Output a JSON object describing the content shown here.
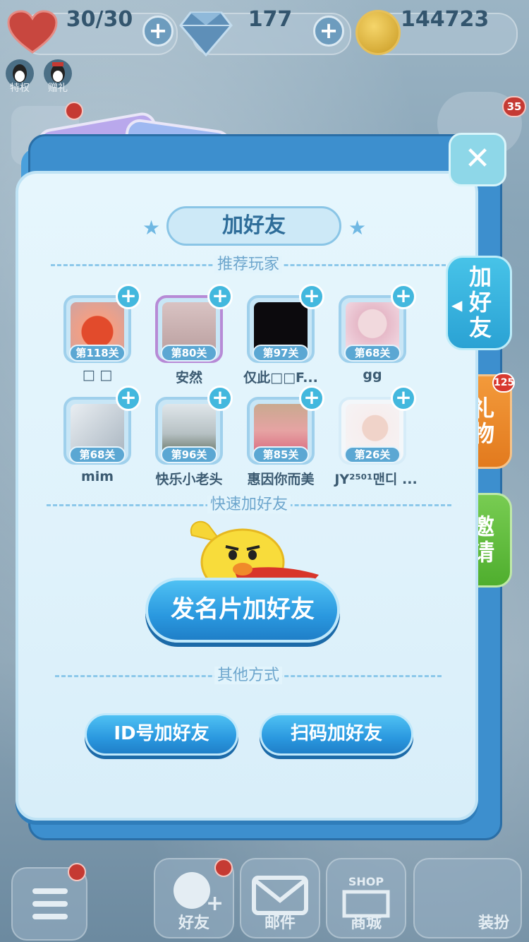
{
  "top_bar": {
    "lives": "30/30",
    "gems": "177",
    "coins": "144723",
    "qq_labels": [
      "特权",
      "赠礼"
    ]
  },
  "dialog": {
    "title": "加好友",
    "sections": {
      "recommended": "推荐玩家",
      "quick": "快速加好友",
      "other": "其他方式"
    },
    "players": [
      {
        "name": "□ □",
        "level": "第118关"
      },
      {
        "name": "安然",
        "level": "第80关"
      },
      {
        "name": "仅此□□F...",
        "level": "第97关"
      },
      {
        "name": "gg",
        "level": "第68关"
      },
      {
        "name": "mim",
        "level": "第68关"
      },
      {
        "name": "快乐小老头",
        "level": "第96关"
      },
      {
        "name": "惠因你而美",
        "level": "第85关"
      },
      {
        "name": "JY²⁵⁰¹맨디 ...",
        "level": "第26关"
      }
    ],
    "card_button": "发名片加好友",
    "id_button": "ID号加好友",
    "scan_button": "扫码加好友"
  },
  "side_tabs": {
    "add_friend": "加好友",
    "gift": "礼物",
    "invite": "邀请",
    "gift_badge": "125"
  },
  "bottom_bar": {
    "friends": "好友",
    "mail": "邮件",
    "shop": "商城",
    "shop_sign": "SHOP",
    "dress": "装扮",
    "top_right_badge": "35"
  },
  "colors": {
    "accent": "#2a98df",
    "panel": "#e2f4fc",
    "gift_tab": "#e27a1e",
    "invite_tab": "#4fae2e"
  }
}
